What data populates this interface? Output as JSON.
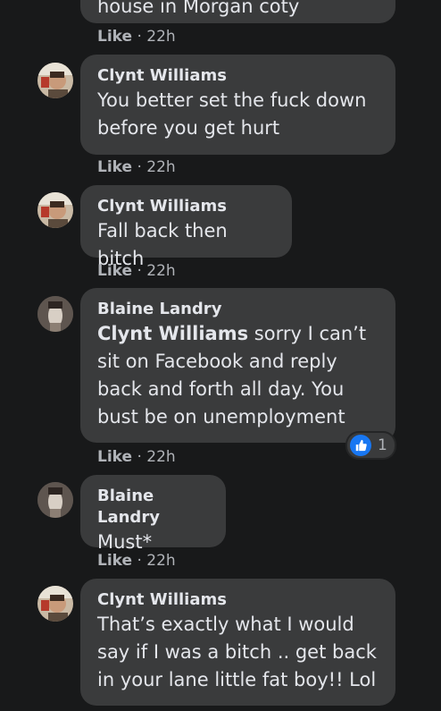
{
  "comments": [
    {
      "name": "",
      "text": "house in Morgan coty",
      "like_label": "Like",
      "time": "22h"
    },
    {
      "name": "Clynt Williams",
      "text": "You better set the fuck down before you get hurt",
      "like_label": "Like",
      "time": "22h"
    },
    {
      "name": "Clynt Williams",
      "text": "Fall back then bitch",
      "like_label": "Like",
      "time": "22h"
    },
    {
      "name": "Blaine Landry",
      "mention": "Clynt Williams",
      "text": " sorry I can’t sit on Facebook and reply back and forth all day. You bust be on unemployment",
      "like_label": "Like",
      "time": "22h",
      "reaction": {
        "icon": "like-thumb-icon",
        "count": "1"
      }
    },
    {
      "name": "Blaine Landry",
      "text": "Must*",
      "like_label": "Like",
      "time": "22h"
    },
    {
      "name": "Clynt Williams",
      "text": "That’s exactly what I would say if I was a bitch .. get back in your lane little fat boy!! Lol"
    }
  ],
  "separator": " · ",
  "colors": {
    "background": "#18191a",
    "bubble": "#3a3b3c",
    "text": "#e4e6eb",
    "meta": "#b0b3b8",
    "like_blue": "#1877f2"
  }
}
